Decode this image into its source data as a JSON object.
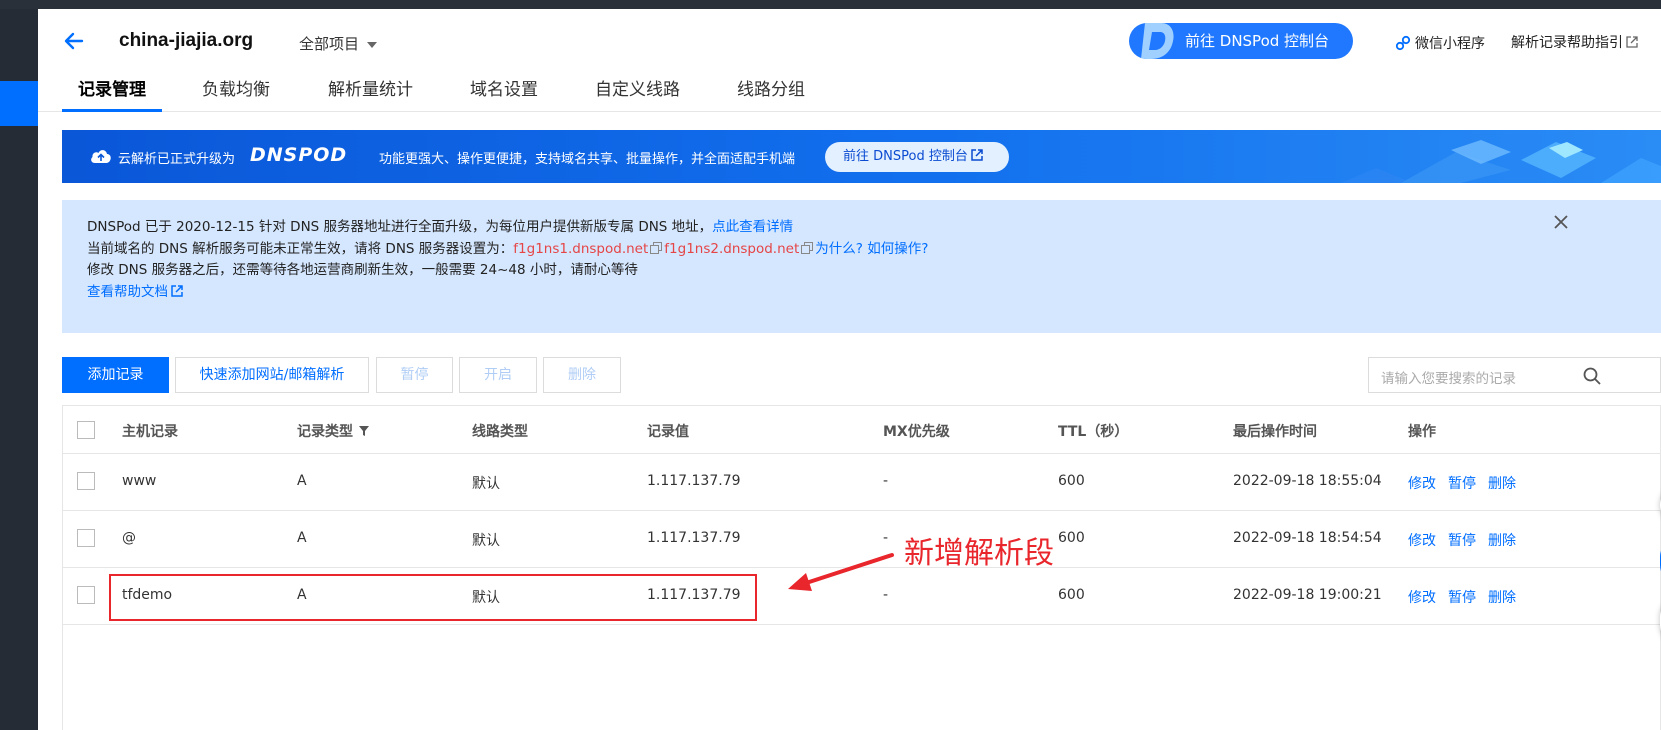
{
  "header": {
    "domain": "china-jiajia.org",
    "project_select": "全部项目",
    "goto_button": "前往 DNSPod 控制台",
    "wechat_mini": "微信小程序",
    "help_guide": "解析记录帮助指引"
  },
  "tabs": [
    {
      "label": "记录管理",
      "active": true
    },
    {
      "label": "负载均衡"
    },
    {
      "label": "解析量统计"
    },
    {
      "label": "域名设置"
    },
    {
      "label": "自定义线路"
    },
    {
      "label": "线路分组"
    }
  ],
  "banner": {
    "text1": "云解析已正式升级为",
    "brand": "DNSPOD",
    "text2": "功能更强大、操作更便捷，支持域名共享、批量操作，并全面适配手机端",
    "button": "前往 DNSPod 控制台"
  },
  "notice": {
    "line1_text": "DNSPod 已于 2020-12-15 针对 DNS 服务器地址进行全面升级，为每位用户提供新版专属 DNS 地址，",
    "line1_link": "点此查看详情",
    "line2_text": "当前域名的 DNS 解析服务可能未正常生效，请将 DNS 服务器设置为：",
    "ns1": "f1g1ns1.dnspod.net",
    "ns2": "f1g1ns2.dnspod.net",
    "line2_link": "为什么? 如何操作?",
    "line3_text": "修改 DNS 服务器之后，还需等待各地运营商刷新生效，一般需要 24~48 小时，请耐心等待",
    "help_doc": "查看帮助文档"
  },
  "toolbar": {
    "add": "添加记录",
    "quick_add": "快速添加网站/邮箱解析",
    "pause": "暂停",
    "enable": "开启",
    "delete": "删除",
    "search_placeholder": "请输入您要搜索的记录"
  },
  "table": {
    "headers": [
      "主机记录",
      "记录类型",
      "线路类型",
      "记录值",
      "MX优先级",
      "TTL（秒）",
      "最后操作时间",
      "操作"
    ],
    "rows": [
      {
        "host": "www",
        "type": "A",
        "line": "默认",
        "value": "1.117.137.79",
        "mx": "-",
        "ttl": "600",
        "time": "2022-09-18 18:55:04"
      },
      {
        "host": "@",
        "type": "A",
        "line": "默认",
        "value": "1.117.137.79",
        "mx": "-",
        "ttl": "600",
        "time": "2022-09-18 18:54:54"
      },
      {
        "host": "tfdemo",
        "type": "A",
        "line": "默认",
        "value": "1.117.137.79",
        "mx": "-",
        "ttl": "600",
        "time": "2022-09-18 19:00:21"
      }
    ],
    "actions": {
      "edit": "修改",
      "pause": "暂停",
      "delete": "删除"
    }
  },
  "annotation": {
    "text": "新增解析段",
    "color": "#e8262c"
  },
  "colors": {
    "primary": "#006eff",
    "nav_dark": "#262c36",
    "notice_bg": "#d5e7ff",
    "ns_red": "#e54545"
  }
}
